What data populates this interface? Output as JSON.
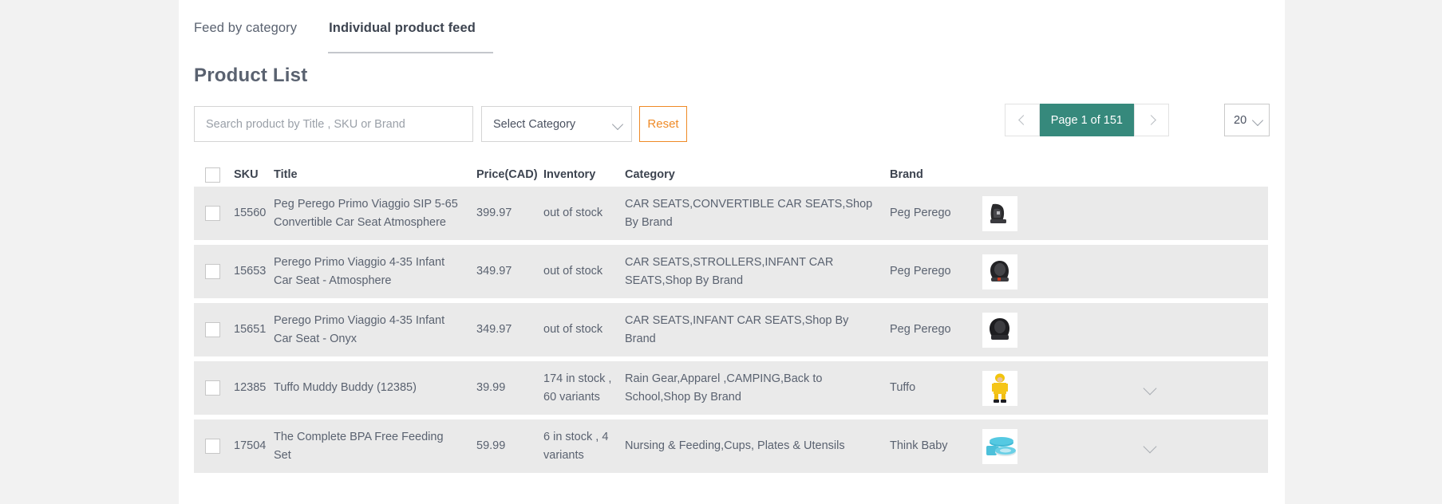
{
  "tabs": [
    {
      "label": "Feed by category",
      "active": false
    },
    {
      "label": "Individual product feed",
      "active": true
    }
  ],
  "page_title": "Product List",
  "toolbar": {
    "search_placeholder": "Search product by Title , SKU or Brand",
    "search_value": "",
    "category_select_label": "Select Category",
    "reset_label": "Reset",
    "page_label": "Page 1 of 151",
    "prev_icon": "chevron-left-icon",
    "next_icon": "chevron-right-icon",
    "page_size": "20"
  },
  "colors": {
    "accent_teal": "#36897c",
    "accent_orange": "#ef8a26",
    "out_of_stock": "#ef6c1a",
    "row_bg": "#eaeaea",
    "page_bg": "#f2f2f2"
  },
  "table": {
    "columns": [
      "SKU",
      "Title",
      "Price(CAD)",
      "Inventory",
      "Category",
      "Brand"
    ],
    "rows": [
      {
        "sku": "15560",
        "title": "Peg Perego Primo Viaggio SIP 5-65 Convertible Car Seat Atmosphere",
        "price": "399.97",
        "inventory": "out of stock",
        "out_of_stock": true,
        "category": "CAR SEATS,CONVERTIBLE CAR SEATS,Shop By Brand",
        "brand": "Peg Perego",
        "thumb": "car-seat-black",
        "expandable": false
      },
      {
        "sku": "15653",
        "title": "Perego Primo Viaggio 4-35 Infant Car Seat - Atmosphere",
        "price": "349.97",
        "inventory": "out of stock",
        "out_of_stock": true,
        "category": "CAR SEATS,STROLLERS,INFANT CAR SEATS,Shop By Brand",
        "brand": "Peg Perego",
        "thumb": "infant-car-seat-black",
        "expandable": false
      },
      {
        "sku": "15651",
        "title": "Perego Primo Viaggio 4-35 Infant Car Seat - Onyx",
        "price": "349.97",
        "inventory": "out of stock",
        "out_of_stock": true,
        "category": "CAR SEATS,INFANT CAR SEATS,Shop By Brand",
        "brand": "Peg Perego",
        "thumb": "infant-car-seat-onyx",
        "expandable": false
      },
      {
        "sku": "12385",
        "title": "Tuffo Muddy Buddy (12385)",
        "price": "39.99",
        "inventory": "174 in stock , 60 variants",
        "out_of_stock": false,
        "category": "Rain Gear,Apparel ,CAMPING,Back to School,Shop By Brand",
        "brand": "Tuffo",
        "thumb": "child-yellow-rainsuit",
        "expandable": true
      },
      {
        "sku": "17504",
        "title": "The Complete BPA Free Feeding Set",
        "price": "59.99",
        "inventory": "6 in stock , 4 variants",
        "out_of_stock": false,
        "category": "Nursing & Feeding,Cups, Plates & Utensils",
        "brand": "Think Baby",
        "thumb": "teal-feeding-set",
        "expandable": true
      }
    ]
  }
}
